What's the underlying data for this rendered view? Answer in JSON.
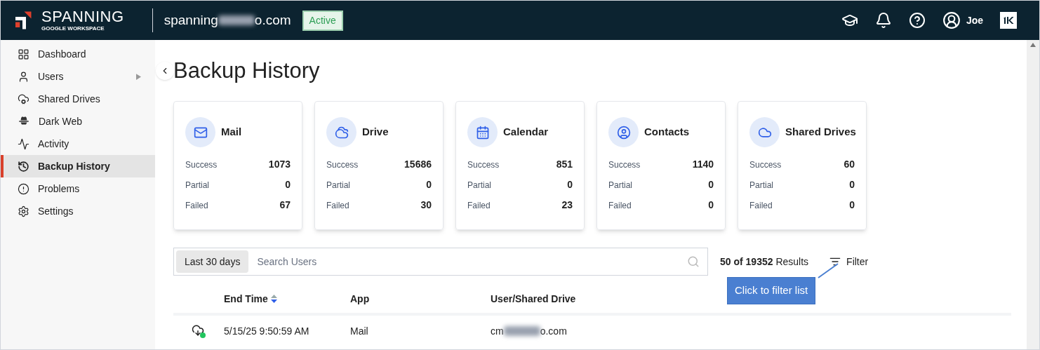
{
  "header": {
    "brand": "SPANNING",
    "subbrand": "GOOGLE WORKSPACE",
    "domain_start": "spanning",
    "domain_end": "o.com",
    "status": "Active",
    "user": "Joe"
  },
  "sidebar": {
    "items": [
      {
        "label": "Dashboard",
        "selected": false,
        "submenu": false
      },
      {
        "label": "Users",
        "selected": false,
        "submenu": true
      },
      {
        "label": "Shared Drives",
        "selected": false,
        "submenu": false
      },
      {
        "label": "Dark Web",
        "selected": false,
        "submenu": false
      },
      {
        "label": "Activity",
        "selected": false,
        "submenu": false
      },
      {
        "label": "Backup History",
        "selected": true,
        "submenu": false
      },
      {
        "label": "Problems",
        "selected": false,
        "submenu": false
      },
      {
        "label": "Settings",
        "selected": false,
        "submenu": false
      }
    ]
  },
  "page_title": "Backup History",
  "cards": [
    {
      "title": "Mail",
      "stats": [
        {
          "label": "Success",
          "value": "1073"
        },
        {
          "label": "Partial",
          "value": "0"
        },
        {
          "label": "Failed",
          "value": "67"
        }
      ]
    },
    {
      "title": "Drive",
      "stats": [
        {
          "label": "Success",
          "value": "15686"
        },
        {
          "label": "Partial",
          "value": "0"
        },
        {
          "label": "Failed",
          "value": "30"
        }
      ]
    },
    {
      "title": "Calendar",
      "stats": [
        {
          "label": "Success",
          "value": "851"
        },
        {
          "label": "Partial",
          "value": "0"
        },
        {
          "label": "Failed",
          "value": "23"
        }
      ]
    },
    {
      "title": "Contacts",
      "stats": [
        {
          "label": "Success",
          "value": "1140"
        },
        {
          "label": "Partial",
          "value": "0"
        },
        {
          "label": "Failed",
          "value": "0"
        }
      ]
    },
    {
      "title": "Shared Drives",
      "stats": [
        {
          "label": "Success",
          "value": "60"
        },
        {
          "label": "Partial",
          "value": "0"
        },
        {
          "label": "Failed",
          "value": "0"
        }
      ]
    }
  ],
  "toolbar": {
    "range": "Last 30 days",
    "search_placeholder": "Search Users",
    "results": "**50 of 19352** Results",
    "filter": "Filter",
    "tooltip": "Click to filter list"
  },
  "table": {
    "columns": [
      {
        "label": "End Time",
        "sortable": true
      },
      {
        "label": "App",
        "sortable": false
      },
      {
        "label": "User/Shared Drive",
        "sortable": false
      }
    ],
    "rows": [
      {
        "time": "5/15/25 9:50:59 AM",
        "app": "Mail",
        "user_start": "cm",
        "user_end": "o.com"
      }
    ]
  }
}
